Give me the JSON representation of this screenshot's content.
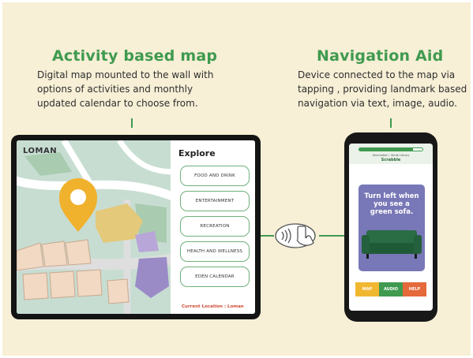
{
  "left": {
    "title": "Activity based map",
    "lines": [
      "Digital map mounted to the wall with",
      "options of activities and monthly",
      "updated calendar to choose from."
    ]
  },
  "right": {
    "title": "Navigation Aid",
    "lines": [
      "Device connected to the map via",
      "tapping , providing landmark based",
      "navigation via text, image, audio."
    ]
  },
  "tablet": {
    "logo": "LOMAN",
    "explore_title": "Explore",
    "buttons": [
      "FOOD AND DRINK",
      "ENTERTAINMENT",
      "RECREATION",
      "HEALTH AND WELLNESS",
      "EDEN CALENDAR"
    ],
    "current_location": "Current Location : Loman"
  },
  "phone": {
    "progress": 0.85,
    "destination_label": "Destination : Verde Library",
    "destination_value": "Scrabble",
    "instruction": "Turn left when you see a green sofa.",
    "actions": [
      {
        "label": "MAP",
        "color": "#f1b731"
      },
      {
        "label": "AUDIO",
        "color": "#3f9a4f"
      },
      {
        "label": "HELP",
        "color": "#e5693a"
      }
    ]
  },
  "colors": {
    "accent_green": "#3f9a4f",
    "pin_yellow": "#f0b12c",
    "card_purple": "#7877b7"
  }
}
